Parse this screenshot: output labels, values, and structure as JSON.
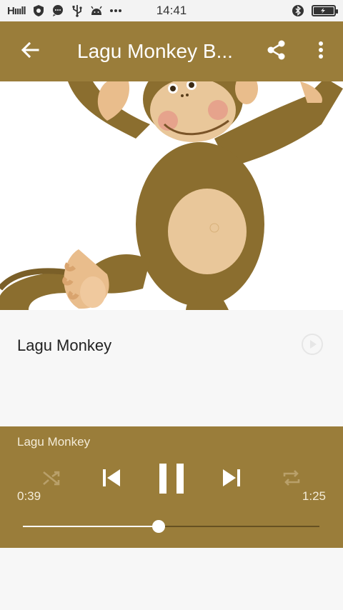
{
  "status_bar": {
    "signal": "Hıııll",
    "time": "14:41",
    "icons": [
      "shield-icon",
      "chat-icon",
      "usb-icon",
      "android-icon",
      "more-icon",
      "bluetooth-icon",
      "battery-icon"
    ]
  },
  "app_bar": {
    "title": "Lagu Monkey B...",
    "back_icon": "arrow-left-icon",
    "share_icon": "share-icon",
    "menu_icon": "more-vertical-icon"
  },
  "track": {
    "title": "Lagu Monkey"
  },
  "player": {
    "now_playing": "Lagu Monkey",
    "elapsed": "0:39",
    "duration": "1:25",
    "progress_percent": 45.9,
    "state": "playing",
    "shuffle": false,
    "repeat": false
  },
  "colors": {
    "accent": "#9a7d3a",
    "text_light": "#f4ecd8",
    "background": "#f7f7f7"
  }
}
